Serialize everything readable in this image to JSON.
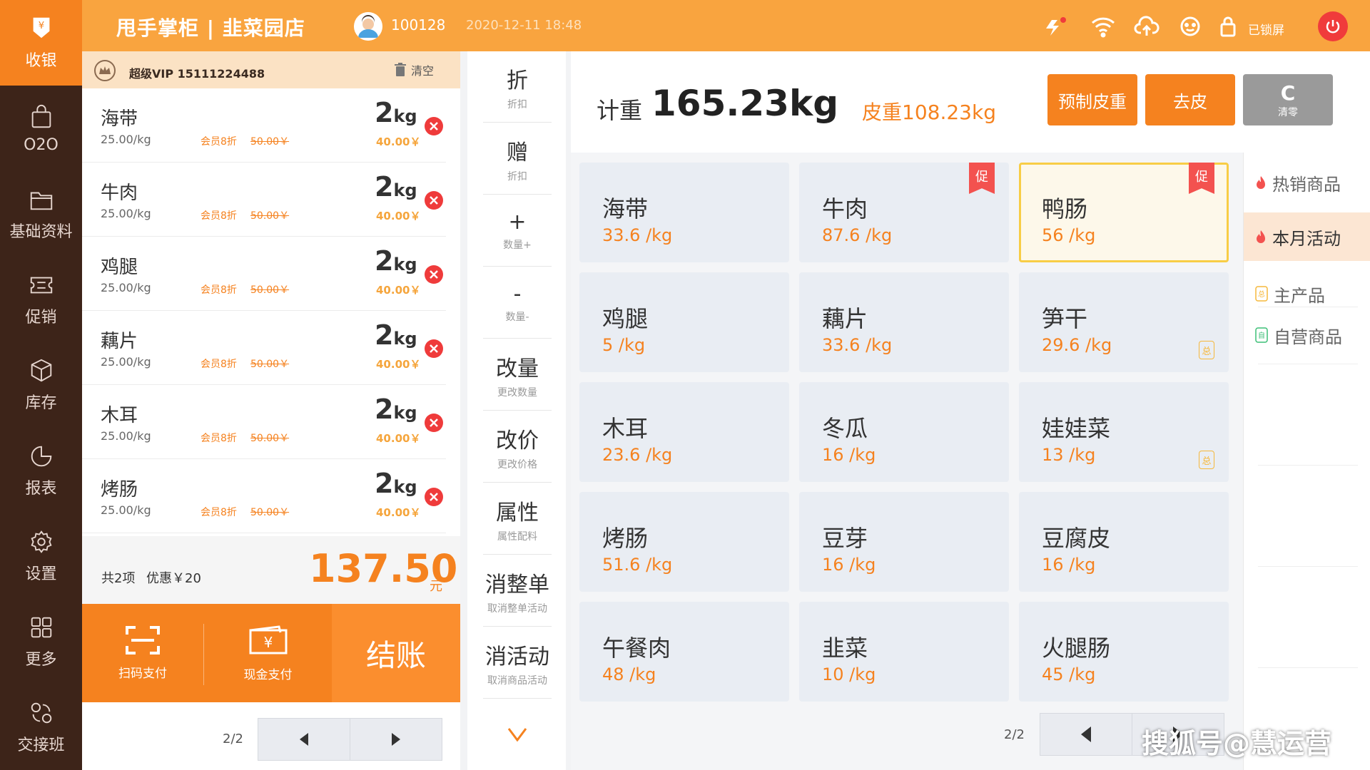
{
  "nav": {
    "items": [
      {
        "label": "收银",
        "icon": "cashier-icon"
      },
      {
        "label": "O2O",
        "icon": "bag-icon"
      },
      {
        "label": "基础资料",
        "icon": "folder-icon"
      },
      {
        "label": "促销",
        "icon": "ticket-icon"
      },
      {
        "label": "库存",
        "icon": "cube-icon"
      },
      {
        "label": "报表",
        "icon": "pie-chart-icon"
      },
      {
        "label": "设置",
        "icon": "gear-icon"
      },
      {
        "label": "更多",
        "icon": "grid-icon"
      },
      {
        "label": "交接班",
        "icon": "handover-icon"
      }
    ]
  },
  "header": {
    "title": "甩手掌柜 | 韭菜园店",
    "user_id": "100128",
    "datetime": "2020-12-11  18:48",
    "lock_text": "已锁屏"
  },
  "order": {
    "vip": "超级VIP  15111224488",
    "clear_label": "清空",
    "items": [
      {
        "name": "海带",
        "unit_price": "25.00/kg",
        "discount": "会员8折",
        "old_price": "50.00￥",
        "qty": "2",
        "unit": "kg",
        "total": "40.00￥"
      },
      {
        "name": "牛肉",
        "unit_price": "25.00/kg",
        "discount": "会员8折",
        "old_price": "50.00￥",
        "qty": "2",
        "unit": "kg",
        "total": "40.00￥"
      },
      {
        "name": "鸡腿",
        "unit_price": "25.00/kg",
        "discount": "会员8折",
        "old_price": "50.00￥",
        "qty": "2",
        "unit": "kg",
        "total": "40.00￥"
      },
      {
        "name": "藕片",
        "unit_price": "25.00/kg",
        "discount": "会员8折",
        "old_price": "50.00￥",
        "qty": "2",
        "unit": "kg",
        "total": "40.00￥"
      },
      {
        "name": "木耳",
        "unit_price": "25.00/kg",
        "discount": "会员8折",
        "old_price": "50.00￥",
        "qty": "2",
        "unit": "kg",
        "total": "40.00￥"
      },
      {
        "name": "烤肠",
        "unit_price": "25.00/kg",
        "discount": "会员8折",
        "old_price": "50.00￥",
        "qty": "2",
        "unit": "kg",
        "total": "40.00￥"
      }
    ],
    "summary_count": "共2项",
    "summary_discount": "优惠￥20",
    "total": "137.50",
    "total_unit": "元",
    "scan_pay": "扫码支付",
    "cash_pay": "现金支付",
    "checkout": "结账",
    "page": "2/2"
  },
  "actions": [
    {
      "title": "折",
      "sub": "折扣"
    },
    {
      "title": "赠",
      "sub": "折扣"
    },
    {
      "title": "+",
      "sub": "数量+"
    },
    {
      "title": "-",
      "sub": "数量-"
    },
    {
      "title": "改量",
      "sub": "更改数量"
    },
    {
      "title": "改价",
      "sub": "更改价格"
    },
    {
      "title": "属性",
      "sub": "属性配料"
    },
    {
      "title": "消整单",
      "sub": "取消整单活动"
    },
    {
      "title": "消活动",
      "sub": "取消商品活动"
    }
  ],
  "scale": {
    "weight_label": "计重",
    "weight_value": "165.23kg",
    "tare_label": "皮重108.23kg",
    "preset_tare": "预制皮重",
    "remove_tare": "去皮",
    "zero_main": "C",
    "zero_sub": "清零"
  },
  "products": [
    {
      "name": "海带",
      "price": "33.6 /kg"
    },
    {
      "name": "牛肉",
      "price": "87.6 /kg",
      "promo": "促"
    },
    {
      "name": "鸭肠",
      "price": "56 /kg",
      "promo": "促",
      "selected": true
    },
    {
      "name": "鸡腿",
      "price": "5 /kg"
    },
    {
      "name": "藕片",
      "price": "33.6 /kg"
    },
    {
      "name": "笋干",
      "price": "29.6 /kg",
      "tag": "总"
    },
    {
      "name": "木耳",
      "price": "23.6 /kg"
    },
    {
      "name": "冬瓜",
      "price": "16 /kg"
    },
    {
      "name": "娃娃菜",
      "price": "13 /kg",
      "tag": "总"
    },
    {
      "name": "烤肠",
      "price": "51.6 /kg"
    },
    {
      "name": "豆芽",
      "price": "16 /kg"
    },
    {
      "name": "豆腐皮",
      "price": "16 /kg"
    },
    {
      "name": "午餐肉",
      "price": "48 /kg"
    },
    {
      "name": "韭菜",
      "price": "10 /kg"
    },
    {
      "name": "火腿肠",
      "price": "45 /kg"
    }
  ],
  "grid_page": "2/2",
  "categories": [
    {
      "label": "热销商品",
      "icon": "flame-icon"
    },
    {
      "label": "本月活动",
      "icon": "flame-icon",
      "active": true
    },
    {
      "label": "主产品",
      "icon": "main-product-icon"
    },
    {
      "label": "自营商品",
      "icon": "self-operated-icon"
    }
  ],
  "watermark": "搜狐号@慧运营",
  "colors": {
    "accent": "#f5821f",
    "header": "#f9a43f",
    "nav": "#3d2419",
    "promo": "#f3524f"
  }
}
